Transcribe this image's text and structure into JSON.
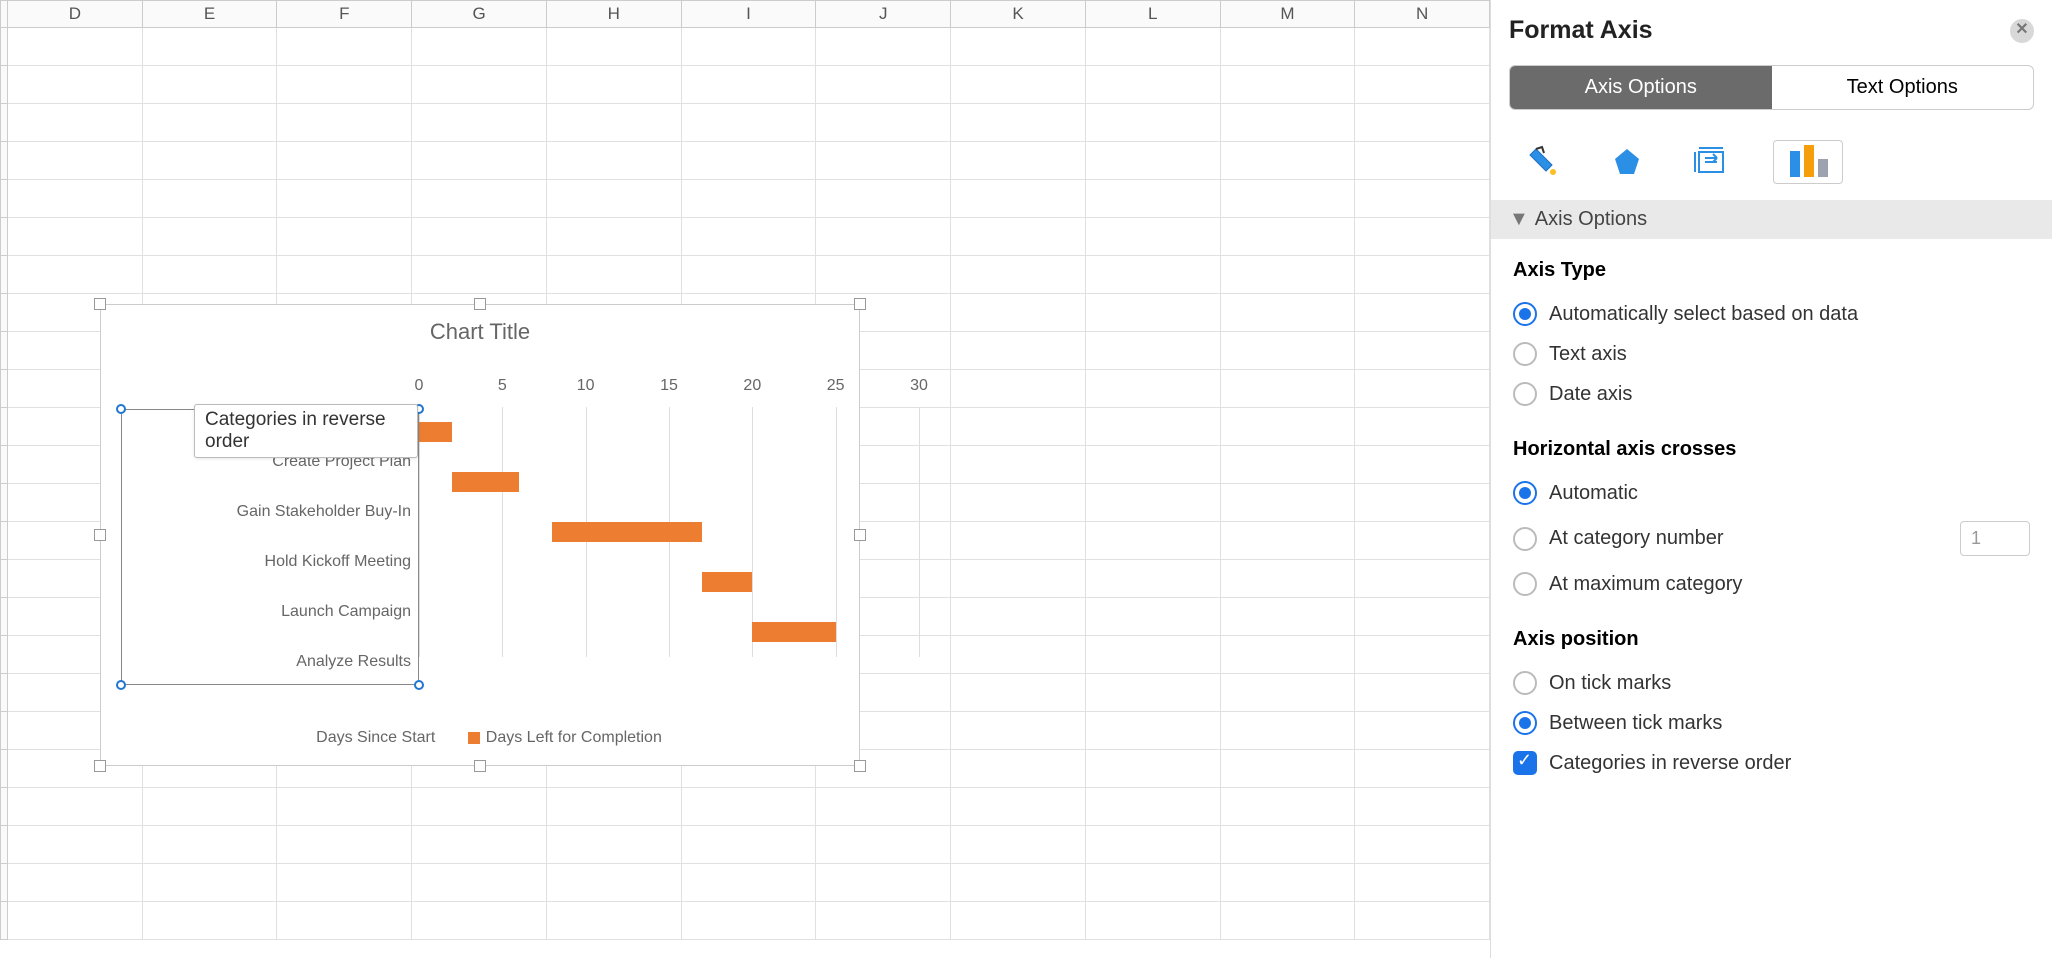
{
  "columns": [
    "D",
    "E",
    "F",
    "G",
    "H",
    "I",
    "J",
    "K",
    "L",
    "M",
    "N"
  ],
  "pane": {
    "title": "Format Axis",
    "tabs": {
      "options": "Axis Options",
      "text": "Text Options"
    },
    "icon_tabs": [
      "fill-icon",
      "effects-icon",
      "size-icon",
      "axis-icon"
    ],
    "section": "Axis Options",
    "axis_type": {
      "heading": "Axis Type",
      "auto": "Automatically select based on data",
      "text": "Text axis",
      "date": "Date axis"
    },
    "crosses": {
      "heading": "Horizontal axis crosses",
      "auto": "Automatic",
      "at_cat": "At category number",
      "at_cat_value": "1",
      "at_max": "At maximum category"
    },
    "position": {
      "heading": "Axis position",
      "on_tick": "On tick marks",
      "between": "Between tick marks",
      "reverse": "Categories in reverse order"
    }
  },
  "tooltip": "Categories in reverse order",
  "chart_data": {
    "type": "bar",
    "title": "Chart Title",
    "xlabel": "",
    "ylabel": "",
    "xlim": [
      0,
      30
    ],
    "ticks": [
      0,
      5,
      10,
      15,
      20,
      25,
      30
    ],
    "categories": [
      "Create Project Plan",
      "Gain Stakeholder Buy-In",
      "Hold Kickoff Meeting",
      "Launch Campaign",
      "Analyze Results"
    ],
    "series": [
      {
        "name": "Days Since Start",
        "values": [
          0,
          2,
          8,
          17,
          20
        ]
      },
      {
        "name": "Days Left for Completion",
        "values": [
          2,
          4,
          9,
          3,
          5
        ]
      }
    ]
  }
}
